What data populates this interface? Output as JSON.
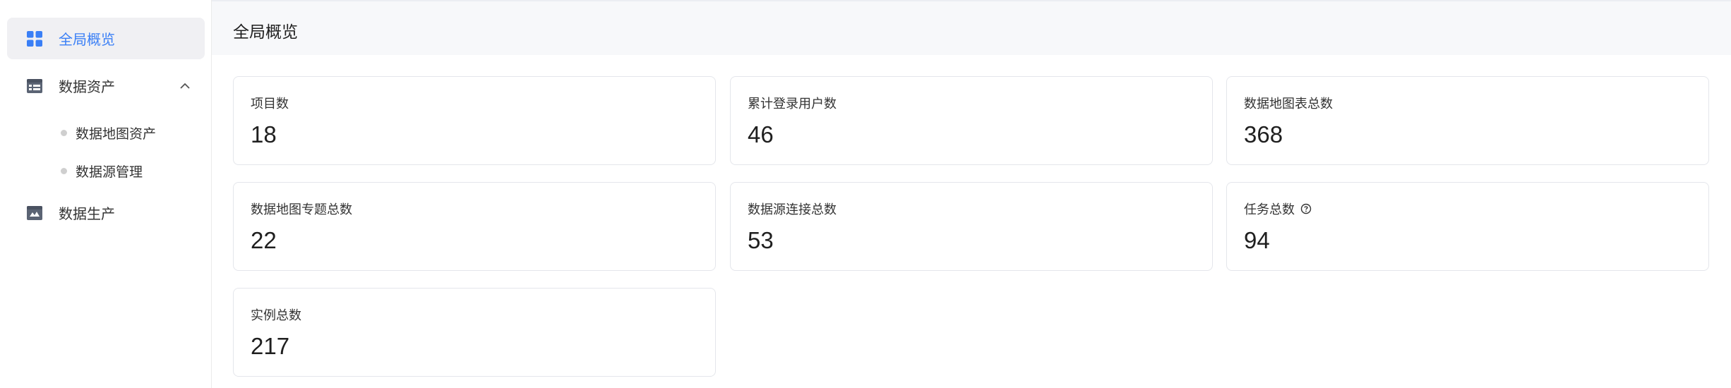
{
  "sidebar": {
    "items": [
      {
        "label": "全局概览",
        "icon": "dashboard-grid-icon",
        "active": true
      },
      {
        "label": "数据资产",
        "icon": "data-asset-icon",
        "expanded": true,
        "children": [
          {
            "label": "数据地图资产"
          },
          {
            "label": "数据源管理"
          }
        ]
      },
      {
        "label": "数据生产",
        "icon": "data-production-icon"
      }
    ]
  },
  "header": {
    "title": "全局概览"
  },
  "stats": [
    {
      "label": "项目数",
      "value": "18"
    },
    {
      "label": "累计登录用户数",
      "value": "46"
    },
    {
      "label": "数据地图表总数",
      "value": "368"
    },
    {
      "label": "数据地图专题总数",
      "value": "22"
    },
    {
      "label": "数据源连接总数",
      "value": "53"
    },
    {
      "label": "任务总数",
      "value": "94",
      "help_icon": "question-circle-icon"
    },
    {
      "label": "实例总数",
      "value": "217"
    }
  ],
  "colors": {
    "accent": "#3a7ff6",
    "header_bg": "#f7f8fa",
    "card_border": "#e4e6eb"
  }
}
